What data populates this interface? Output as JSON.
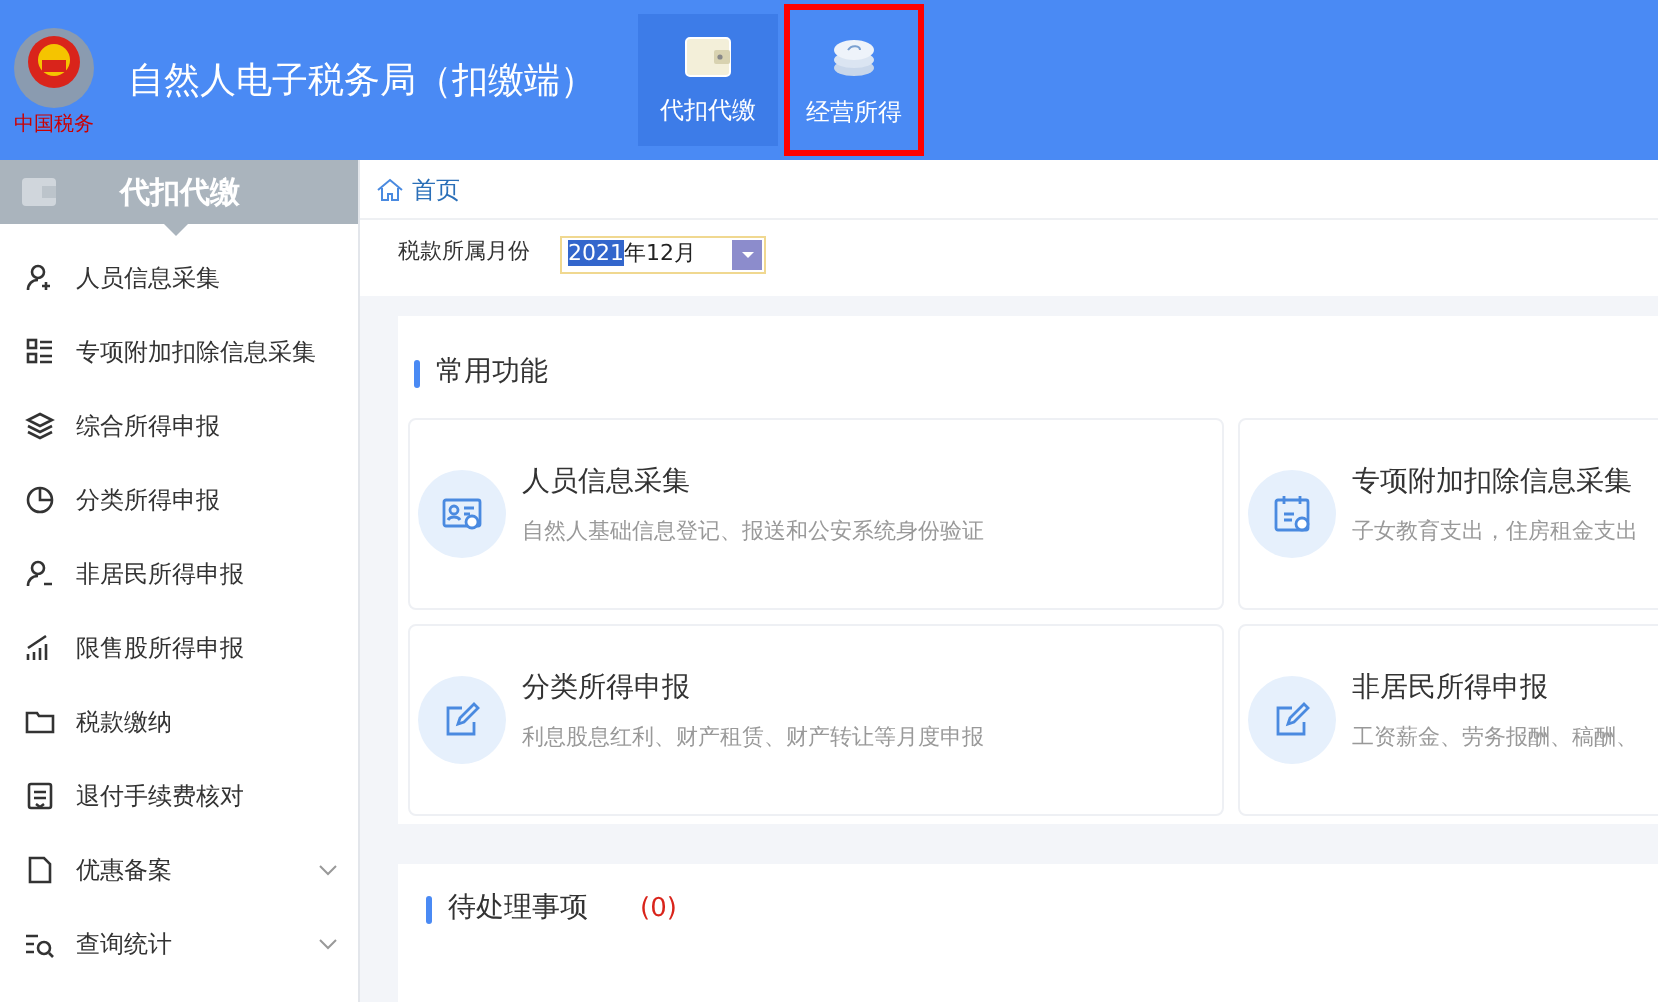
{
  "header": {
    "title": "自然人电子税务局（扣缴端）",
    "emblem_caption": "中国税务",
    "tabs": [
      {
        "label": "代扣代缴",
        "selected": true,
        "highlighted": false,
        "kind": "wallet"
      },
      {
        "label": "经营所得",
        "selected": false,
        "highlighted": true,
        "kind": "coins"
      }
    ]
  },
  "sidebar": {
    "title": "代扣代缴",
    "items": [
      {
        "label": "人员信息采集",
        "kind": "person-add",
        "expandable": false
      },
      {
        "label": "专项附加扣除信息采集",
        "kind": "list",
        "expandable": false
      },
      {
        "label": "综合所得申报",
        "kind": "layers",
        "expandable": false
      },
      {
        "label": "分类所得申报",
        "kind": "pie",
        "expandable": false
      },
      {
        "label": "非居民所得申报",
        "kind": "person",
        "expandable": false
      },
      {
        "label": "限售股所得申报",
        "kind": "bars",
        "expandable": false
      },
      {
        "label": "税款缴纳",
        "kind": "folder",
        "expandable": false
      },
      {
        "label": "退付手续费核对",
        "kind": "doc",
        "expandable": false
      },
      {
        "label": "优惠备案",
        "kind": "page",
        "expandable": true
      },
      {
        "label": "查询统计",
        "kind": "search-list",
        "expandable": true
      }
    ]
  },
  "breadcrumb": "首页",
  "filter": {
    "label": "税款所属月份",
    "value_selected": "2021",
    "value_rest": "年12月"
  },
  "common_functions": {
    "title": "常用功能",
    "cards": [
      {
        "title": "人员信息采集",
        "description": "自然人基础信息登记、报送和公安系统身份验证",
        "kind": "id-card"
      },
      {
        "title": "专项附加扣除信息采集",
        "description": "子女教育支出，住房租金支出",
        "kind": "calendar"
      },
      {
        "title": "分类所得申报",
        "description": "利息股息红利、财产租赁、财产转让等月度申报",
        "kind": "edit"
      },
      {
        "title": "非居民所得申报",
        "description": "工资薪金、劳务报酬、稿酬、",
        "kind": "edit"
      }
    ]
  },
  "pending": {
    "title": "待处理事项",
    "count": "(0)"
  }
}
